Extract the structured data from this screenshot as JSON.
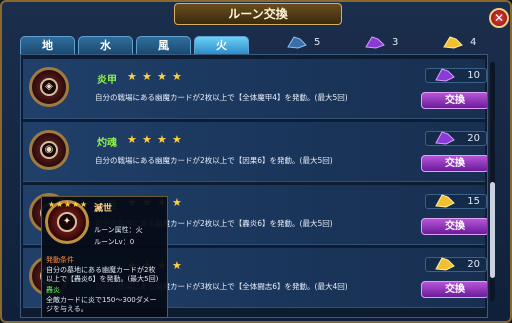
{
  "title": "ルーン交換",
  "close_label": "✕",
  "tabs": [
    {
      "label": "地",
      "active": false
    },
    {
      "label": "水",
      "active": false
    },
    {
      "label": "風",
      "active": false
    },
    {
      "label": "火",
      "active": true
    }
  ],
  "resources": [
    {
      "icon": "blue-shard-icon",
      "color": "#3a6ea8",
      "count": "5"
    },
    {
      "icon": "purple-shard-icon",
      "color": "#8a3ad8",
      "count": "3"
    },
    {
      "icon": "gold-shard-icon",
      "color": "#f0c030",
      "count": "4"
    }
  ],
  "runes": [
    {
      "name": "炎甲",
      "stars": 4,
      "description": "自分の戦場にある幽魔カードが2枚以上で【全体魔甲4】を発動。(最大5回)",
      "cost_icon": "purple-shard-icon",
      "cost_color": "#8a3ad8",
      "cost": "10",
      "button_label": "交換"
    },
    {
      "name": "灼魂",
      "stars": 4,
      "description": "自分の戦場にある幽魔カードが2枚以上で【因果6】を発動。(最大5回)",
      "cost_icon": "purple-shard-icon",
      "cost_color": "#8a3ad8",
      "cost": "20",
      "button_label": "交換"
    },
    {
      "name": "滅世",
      "stars": 4,
      "description": "自分の墓地にある幽魔カードが2枚以上で【轟炎6】を発動。(最大5回)",
      "cost_icon": "gold-shard-icon",
      "cost_color": "#f0c030",
      "cost": "15",
      "button_label": "交換"
    },
    {
      "name": "",
      "stars": 4,
      "description": "自分の戦場にある幽魔カードが3枚以上で【全体闘志6】を発動。(最大4回)",
      "cost_icon": "gold-shard-icon",
      "cost_color": "#f0c030",
      "cost": "20",
      "button_label": "交換"
    }
  ],
  "tooltip": {
    "stars": 5,
    "name": "滅世",
    "attribute": "ルーン属性：火",
    "level": "ルーンLv：0",
    "condition_heading": "発動条件",
    "condition_line1": "自分の墓地にある幽魔カードが2枚",
    "condition_line2": "以上で【轟炎6】を発動。(最大5回)",
    "effect_heading": "轟炎",
    "effect_line1": "全敵カードに炎で150～300ダメー",
    "effect_line2": "ジを与える。"
  }
}
